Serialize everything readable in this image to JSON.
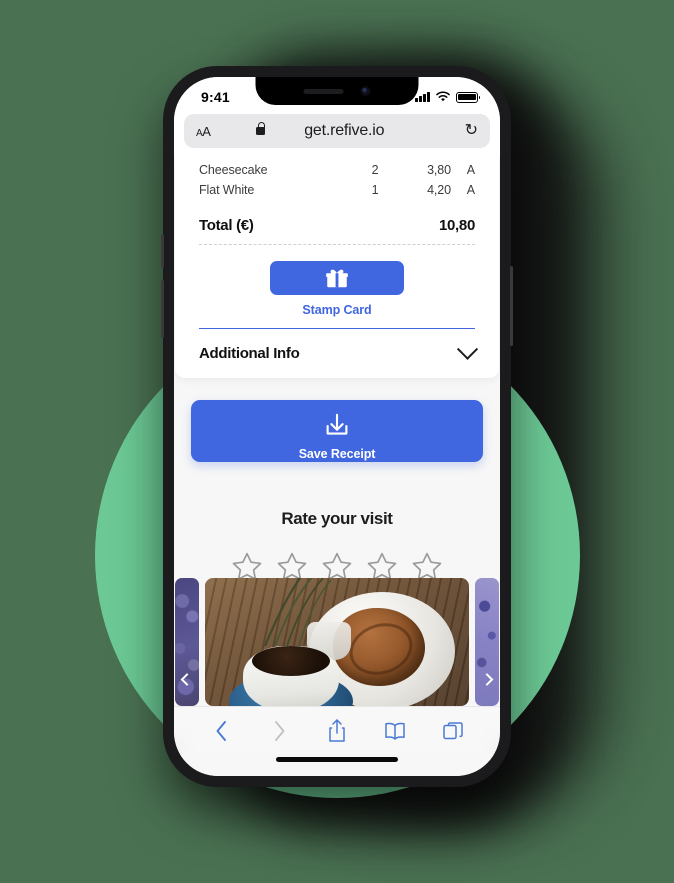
{
  "colors": {
    "page_background": "#4a7152",
    "accent_green": "#6cc995",
    "brand_blue": "#4066e0",
    "screen_background": "#f7f7f7",
    "card_white": "#ffffff"
  },
  "phone": {
    "status_bar": {
      "time": "9:41",
      "signal_icon": "cellular-signal-icon",
      "wifi_icon": "wifi-icon",
      "battery_icon": "battery-icon"
    },
    "browser": {
      "text_size_label": "AA",
      "lock_icon": "lock-icon",
      "url": "get.refive.io",
      "reload_icon": "reload-icon"
    },
    "toolbar": {
      "back_icon": "chevron-left-icon",
      "forward_icon": "chevron-right-icon",
      "share_icon": "share-icon",
      "bookmarks_icon": "book-icon",
      "tabs_icon": "tabs-icon"
    }
  },
  "receipt": {
    "line_items": [
      {
        "name": "Cheesecake",
        "qty": "2",
        "price": "3,80",
        "tax": "A"
      },
      {
        "name": "Flat White",
        "qty": "1",
        "price": "4,20",
        "tax": "A"
      }
    ],
    "total_label": "Total (€)",
    "total_value": "10,80",
    "stamp_card": {
      "icon": "gift-icon",
      "label": "Stamp Card"
    },
    "additional_info": {
      "label": "Additional Info",
      "chevron_icon": "chevron-down-icon"
    }
  },
  "save_receipt": {
    "icon": "download-icon",
    "label": "Save Receipt"
  },
  "rating": {
    "title": "Rate your visit",
    "star_icon": "star-outline-icon",
    "stars": [
      1,
      2,
      3,
      4,
      5
    ],
    "selected": 0
  },
  "carousel": {
    "prev_icon": "chevron-left-icon",
    "next_icon": "chevron-right-icon",
    "slides": [
      {
        "name": "coffee-beans-slide"
      },
      {
        "name": "coffee-and-pastry-slide"
      },
      {
        "name": "purple-texture-slide"
      }
    ]
  }
}
